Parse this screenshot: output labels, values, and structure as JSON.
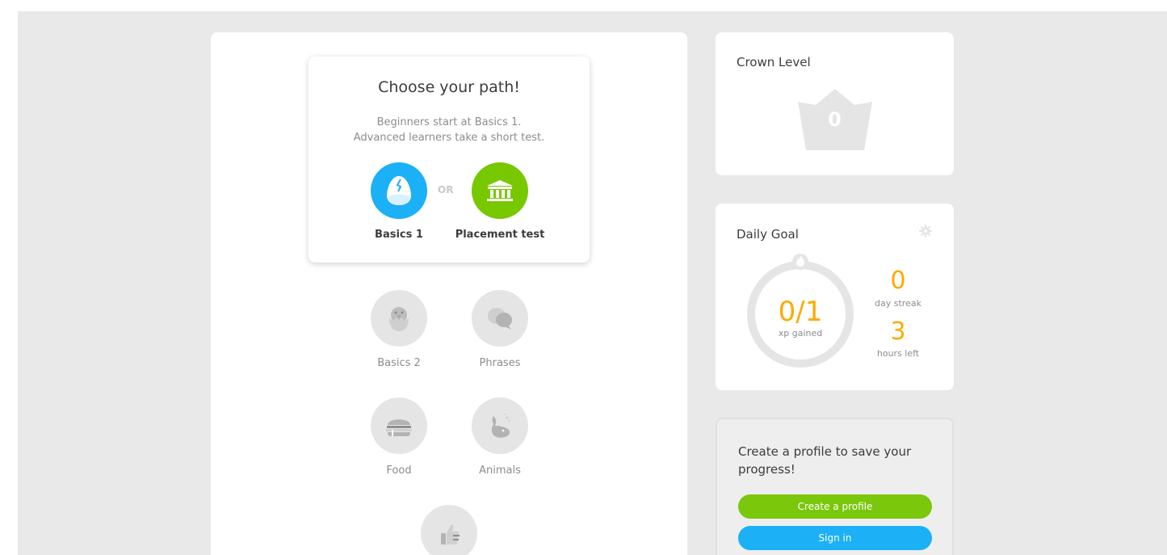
{
  "path_chooser": {
    "title": "Choose your path!",
    "desc_line1": "Beginners start at Basics 1.",
    "desc_line2": "Advanced learners take a short test.",
    "or": "OR",
    "basics1_label": "Basics 1",
    "placement_label": "Placement test"
  },
  "skills": [
    {
      "label": "Basics 2",
      "icon": "chick-icon"
    },
    {
      "label": "Phrases",
      "icon": "speech-bubbles-icon"
    },
    {
      "label": "Food",
      "icon": "burger-icon"
    },
    {
      "label": "Animals",
      "icon": "whale-icon"
    },
    {
      "label": "",
      "icon": "thumbs-up-icon"
    }
  ],
  "crown": {
    "title": "Crown Level",
    "level": "0"
  },
  "daily_goal": {
    "title": "Daily Goal",
    "progress": "0/1",
    "progress_label": "xp gained",
    "streak": "0",
    "streak_label": "day streak",
    "hours": "3",
    "hours_label": "hours left"
  },
  "profile": {
    "text": "Create a profile to save your progress!",
    "create_label": "Create a profile",
    "signin_label": "Sign in"
  },
  "colors": {
    "blue": "#1cb0f6",
    "green": "#78c800",
    "orange": "#ffa900",
    "gray_bg": "#e9e9e9"
  }
}
